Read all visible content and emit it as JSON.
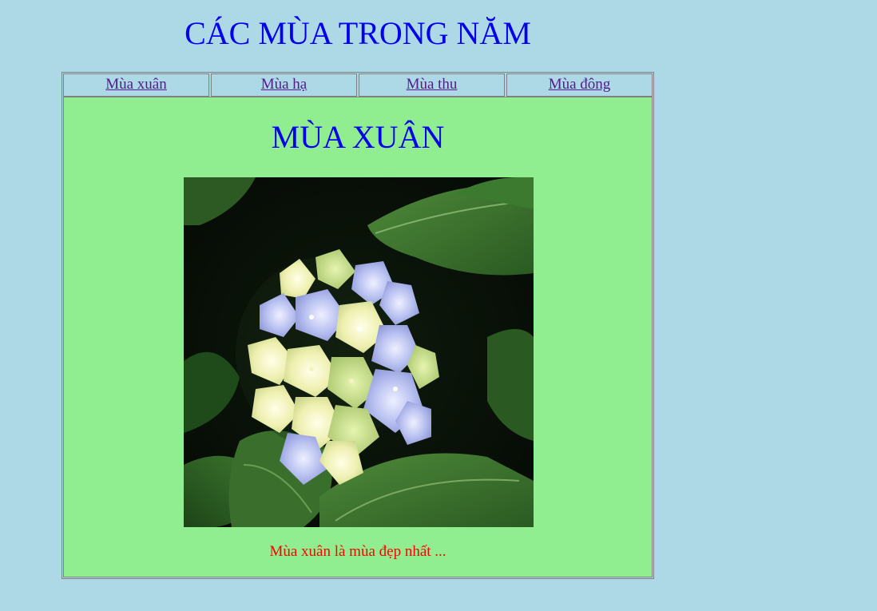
{
  "page": {
    "title": "CÁC MÙA TRONG NĂM"
  },
  "nav": {
    "items": [
      {
        "label": "Mùa xuân"
      },
      {
        "label": "Mùa hạ"
      },
      {
        "label": "Mùa thu"
      },
      {
        "label": "Mùa đông"
      }
    ]
  },
  "content": {
    "season_title": "MÙA XUÂN",
    "caption": "Mùa xuân là mùa đẹp nhất ...",
    "image_subject": "hydrangea-flower"
  },
  "colors": {
    "page_background": "#add8e6",
    "content_background": "#90ee90",
    "title_color": "#0000ee",
    "link_color": "#551a8b",
    "caption_color": "#ff0000"
  }
}
